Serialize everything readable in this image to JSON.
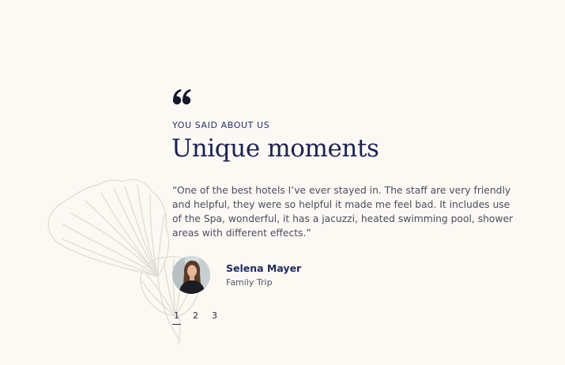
{
  "testimonials": {
    "eyebrow": "YOU SAID ABOUT US",
    "heading": "Unique moments",
    "quote": "“One of the best hotels I’ve ever stayed in. The staff are very friendly and helpful, they were so helpful it made me feel bad. It includes use of the Spa, wonderful, it has a jacuzzi, heated swimming pool, shower areas with different effects.”",
    "author": {
      "name": "Selena Mayer",
      "role": "Family Trip"
    },
    "pagination": {
      "pages": [
        "1",
        "2",
        "3"
      ],
      "active_page": "1"
    }
  },
  "icons": {
    "quote": "quote-icon",
    "leaf": "ginkgo-leaf-icon"
  },
  "colors": {
    "background": "#fcf8f4",
    "heading": "#1d2250",
    "eyebrow": "#27306a",
    "body_text": "#4a4d5c",
    "leaf_outline": "#e2ddd7"
  }
}
